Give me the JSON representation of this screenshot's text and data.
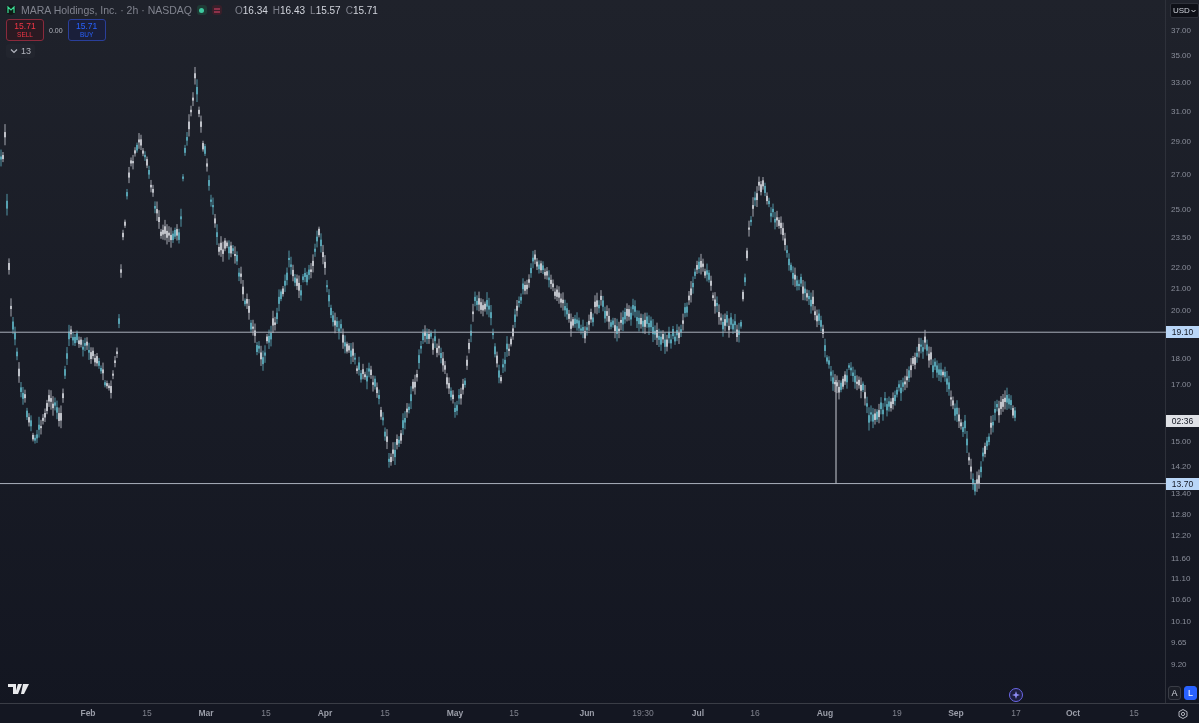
{
  "header": {
    "title": "MARA Holdings, Inc. · 2h · NASDAQ",
    "ohlc": [
      {
        "key": "O",
        "value": "16.34"
      },
      {
        "key": "H",
        "value": "16.43"
      },
      {
        "key": "L",
        "value": "15.57"
      },
      {
        "key": "C",
        "value": "15.71"
      }
    ]
  },
  "trade": {
    "sell_price": "15.71",
    "sell_label": "SELL",
    "spread": "0.00",
    "buy_price": "15.71",
    "buy_label": "BUY"
  },
  "indicators": {
    "expanded": false,
    "count": "13"
  },
  "price_axis": {
    "currency": "USD",
    "countdown": "02:36",
    "ticks": [
      "37.00",
      "35.00",
      "33.00",
      "31.00",
      "29.00",
      "27.00",
      "25.00",
      "23.50",
      "22.00",
      "21.00",
      "20.00",
      "18.00",
      "17.00",
      "15.00",
      "14.20",
      "13.40",
      "12.80",
      "12.20",
      "11.60",
      "11.10",
      "10.60",
      "10.10",
      "9.65",
      "9.20"
    ]
  },
  "horizontal_lines": [
    {
      "price": "19.10"
    },
    {
      "price": "13.70"
    }
  ],
  "time_axis": {
    "ticks": [
      "Feb",
      "15",
      "Mar",
      "15",
      "Apr",
      "15",
      "May",
      "15",
      "Jun",
      "19:30",
      "Jul",
      "16",
      "Aug",
      "19",
      "Sep",
      "17",
      "Oct",
      "15"
    ]
  },
  "scale_buttons": [
    {
      "label": "A",
      "selected": false
    },
    {
      "label": "L",
      "selected": true
    }
  ]
}
